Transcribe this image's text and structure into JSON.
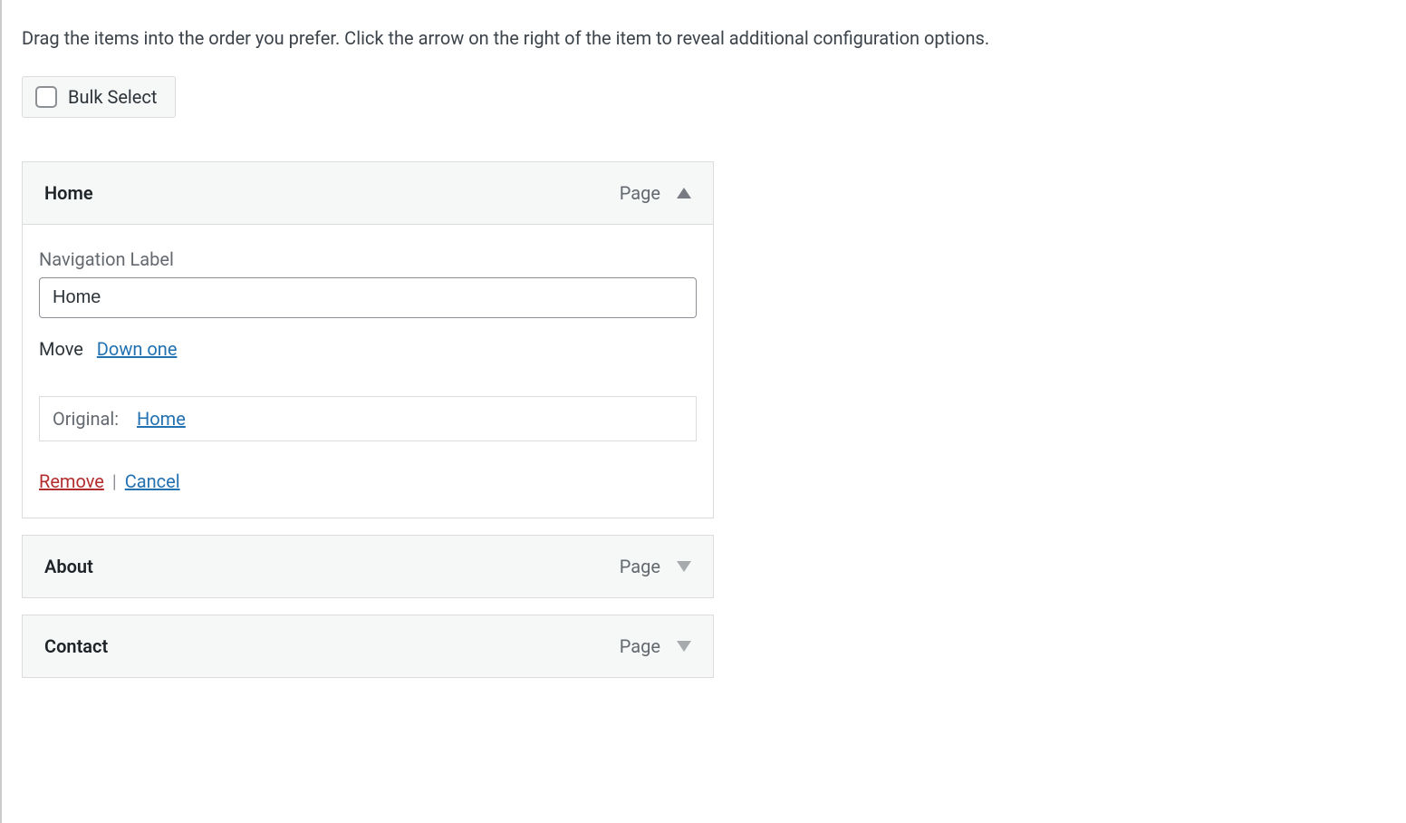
{
  "description": "Drag the items into the order you prefer. Click the arrow on the right of the item to reveal additional configuration options.",
  "bulkSelect": {
    "label": "Bulk Select"
  },
  "items": [
    {
      "title": "Home",
      "type": "Page",
      "expanded": true,
      "settings": {
        "navLabelCaption": "Navigation Label",
        "navLabelValue": "Home",
        "moveLabel": "Move",
        "moveDownLink": "Down one",
        "originalLabel": "Original:",
        "originalLink": "Home",
        "removeLabel": "Remove",
        "cancelLabel": "Cancel"
      }
    },
    {
      "title": "About",
      "type": "Page",
      "expanded": false
    },
    {
      "title": "Contact",
      "type": "Page",
      "expanded": false
    }
  ]
}
